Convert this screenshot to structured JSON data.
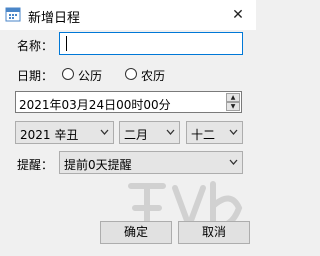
{
  "window": {
    "title": "新增日程",
    "close_glyph": "✕"
  },
  "form": {
    "name_label": "名称：",
    "name_value": "",
    "date_label": "日期：",
    "radio_solar": "公历",
    "radio_lunar": "农历",
    "datetime_value": "2021年03月24日00时00分",
    "year_select": "2021 辛丑",
    "month_select": "二月",
    "day_select": "十二",
    "reminder_label": "提醒：",
    "reminder_select": "提前0天提醒"
  },
  "buttons": {
    "ok": "确定",
    "cancel": "取消"
  },
  "colors": {
    "focus_border": "#0078d7",
    "window_bg": "#f0f0f0"
  },
  "icons": [
    "calendar-app-icon",
    "close-icon",
    "chevron-down-icon",
    "spin-up-icon",
    "spin-down-icon"
  ]
}
